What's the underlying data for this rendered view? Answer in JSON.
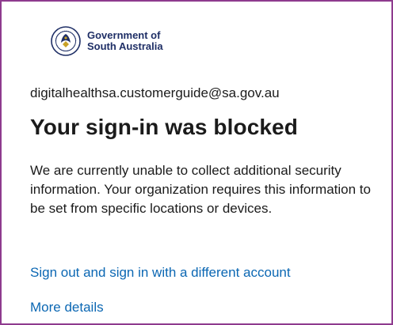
{
  "header": {
    "org_name_line1": "Government of",
    "org_name_line2": "South Australia",
    "seal_icon": "south-australia-seal-icon"
  },
  "account": {
    "email": "digitalhealthsa.customerguide@sa.gov.au"
  },
  "main": {
    "title": "Your sign-in was blocked",
    "message": "We are currently unable to collect additional security information. Your organization requires this information to be set from specific locations or devices.",
    "signout_link": "Sign out and sign in with a different account",
    "details_link": "More details"
  },
  "colors": {
    "link": "#0b67b3",
    "text": "#1b1b1b",
    "brand": "#1f2f66",
    "frame": "#8e3b8e"
  }
}
